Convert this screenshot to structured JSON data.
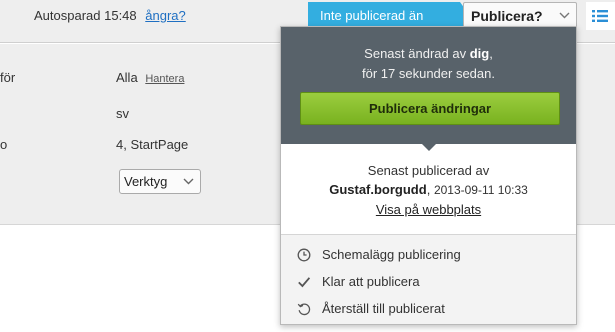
{
  "toolbar": {
    "autosave_text": "Autosparad 15:48",
    "undo_label": "ångra?",
    "status_label": "Inte publicerad än",
    "publish_label": "Publicera?"
  },
  "settings": {
    "rows": [
      {
        "label": "för",
        "value": "Alla",
        "link": "Hantera"
      },
      {
        "label": "",
        "value": "sv"
      },
      {
        "label": "o",
        "value": "4, StartPage"
      }
    ],
    "tools_select": "Verktyg"
  },
  "publish_menu": {
    "changed_prefix": "Senast ändrad av",
    "changed_by": "dig",
    "changed_when": "för 17 sekunder sedan.",
    "publish_changes_label": "Publicera ändringar",
    "published_prefix": "Senast publicerad av",
    "published_by": "Gustaf.borgudd",
    "published_date": "2013-09-11 10:33",
    "view_site_label": "Visa på webbplats",
    "actions": [
      {
        "icon": "clock-icon",
        "label": "Schemalägg publicering"
      },
      {
        "icon": "checkmark-icon",
        "label": "Klar att publicera"
      },
      {
        "icon": "revert-icon",
        "label": "Återställ till publicerat"
      }
    ]
  },
  "colors": {
    "status_blue": "#33aee0",
    "publish_green": "#79b21f",
    "menu_header": "#58626a"
  }
}
